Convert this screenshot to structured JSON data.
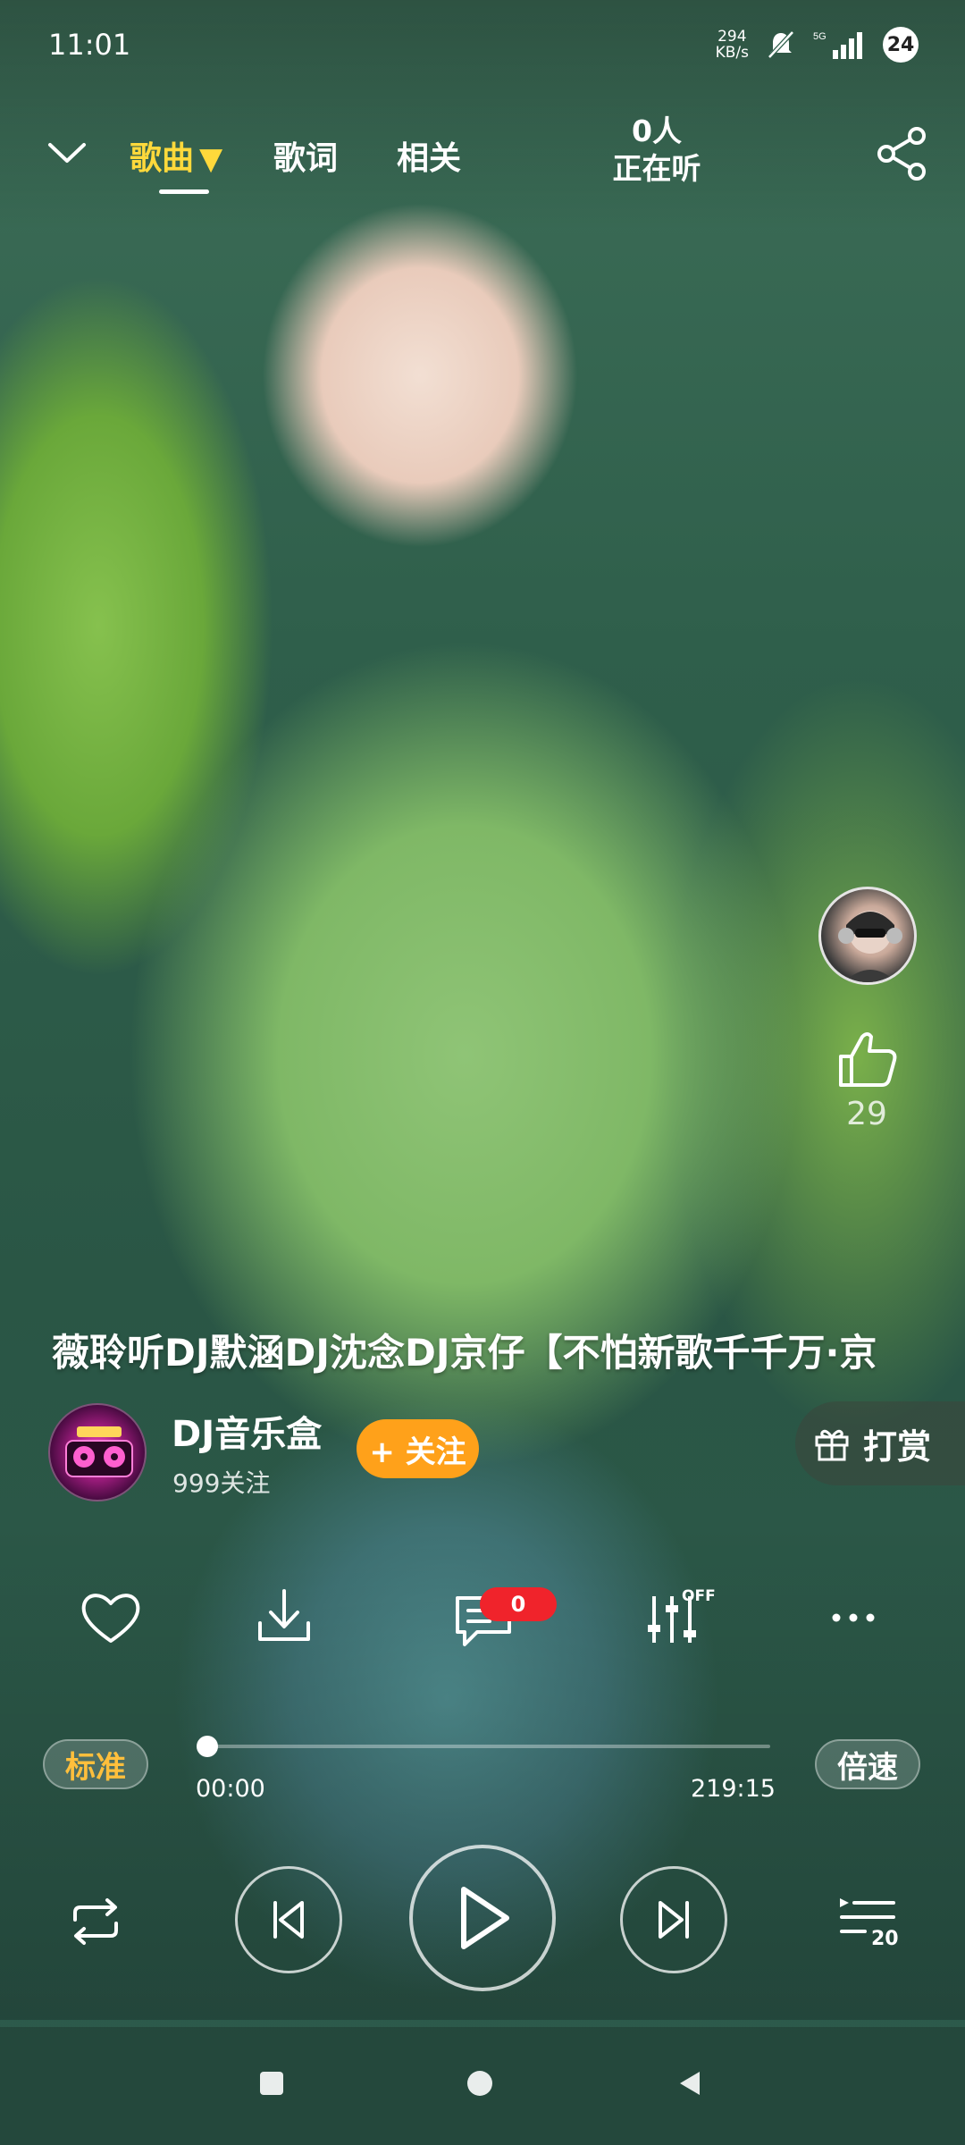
{
  "status_bar": {
    "time": "11:01",
    "net_speed_value": "294",
    "net_speed_unit": "KB/s",
    "network_type": "5G",
    "battery": "24",
    "icons": [
      "mute-icon",
      "signal-icon",
      "battery-icon"
    ]
  },
  "top_nav": {
    "tabs": [
      {
        "label": "歌曲",
        "active": true
      },
      {
        "label": "歌词",
        "active": false
      },
      {
        "label": "相关",
        "active": false
      }
    ],
    "active_indicator": "▼",
    "listeners_count": "0人",
    "listeners_label": "正在听",
    "icons": [
      "chevron-down-icon",
      "share-icon"
    ]
  },
  "side": {
    "like_count": "29",
    "icons": [
      "avatar-icon",
      "thumbs-up-icon"
    ]
  },
  "song": {
    "title": "薇聆听DJ默涵DJ沈念DJ京仔【不怕新歌千千万·京"
  },
  "channel": {
    "name": "DJ音乐盒",
    "followers": "999关注",
    "follow_label": "+ 关注",
    "tip_label": "打赏"
  },
  "actions": {
    "comment_count": "0",
    "effect_state": "OFF",
    "icons": [
      "heart-icon",
      "download-icon",
      "comment-icon",
      "equalizer-icon",
      "more-icon"
    ]
  },
  "player": {
    "quality_label": "标准",
    "speed_label": "倍速",
    "current_time": "00:00",
    "total_time": "219:15",
    "progress": 0.0,
    "playlist_count": "20",
    "icons": [
      "repeat-icon",
      "previous-icon",
      "play-icon",
      "next-icon",
      "playlist-icon"
    ]
  },
  "nav_bar": {
    "icons": [
      "recents-icon",
      "home-icon",
      "back-icon"
    ]
  },
  "colors": {
    "active_tab": "#ffd93b",
    "follow_button": "#ffa11a",
    "badge": "#f0232b",
    "quality_text": "#ffbf3c"
  }
}
